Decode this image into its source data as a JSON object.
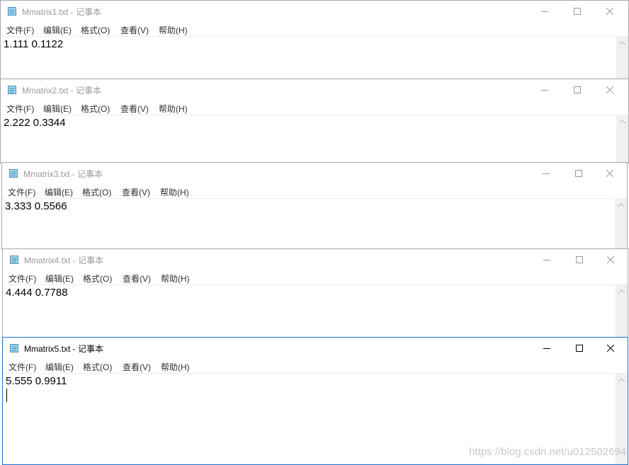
{
  "windows": [
    {
      "title": "Mmatrix1.txt - 记事本",
      "menu": [
        "文件(F)",
        "编辑(E)",
        "格式(O)",
        "查看(V)",
        "帮助(H)"
      ],
      "content": "1.111 0.1122"
    },
    {
      "title": "Mmatrix2.txt - 记事本",
      "menu": [
        "文件(F)",
        "编辑(E)",
        "格式(O)",
        "查看(V)",
        "帮助(H)"
      ],
      "content": "2.222 0.3344"
    },
    {
      "title": "Mmatrix3.txt - 记事本",
      "menu": [
        "文件(F)",
        "编辑(E)",
        "格式(O)",
        "查看(V)",
        "帮助(H)"
      ],
      "content": "3.333 0.5566"
    },
    {
      "title": "Mmatrix4.txt - 记事本",
      "menu": [
        "文件(F)",
        "编辑(E)",
        "格式(O)",
        "查看(V)",
        "帮助(H)"
      ],
      "content": "4.444 0.7788"
    },
    {
      "title": "Mmatrix5.txt - 记事本",
      "menu": [
        "文件(F)",
        "编辑(E)",
        "格式(O)",
        "查看(V)",
        "帮助(H)"
      ],
      "content": "5.555 0.9911"
    }
  ],
  "active_window_index": 4,
  "icons": {
    "app": "notepad-icon",
    "minimize": "minimize-icon",
    "maximize": "maximize-icon",
    "close": "close-icon",
    "scroll_up": "scroll-up-arrow-icon"
  },
  "colors": {
    "active_border": "#1e6fc9",
    "inactive_title": "#9a9a9a",
    "active_title": "#000000"
  },
  "watermark": "https://blog.csdn.net/u012502694"
}
